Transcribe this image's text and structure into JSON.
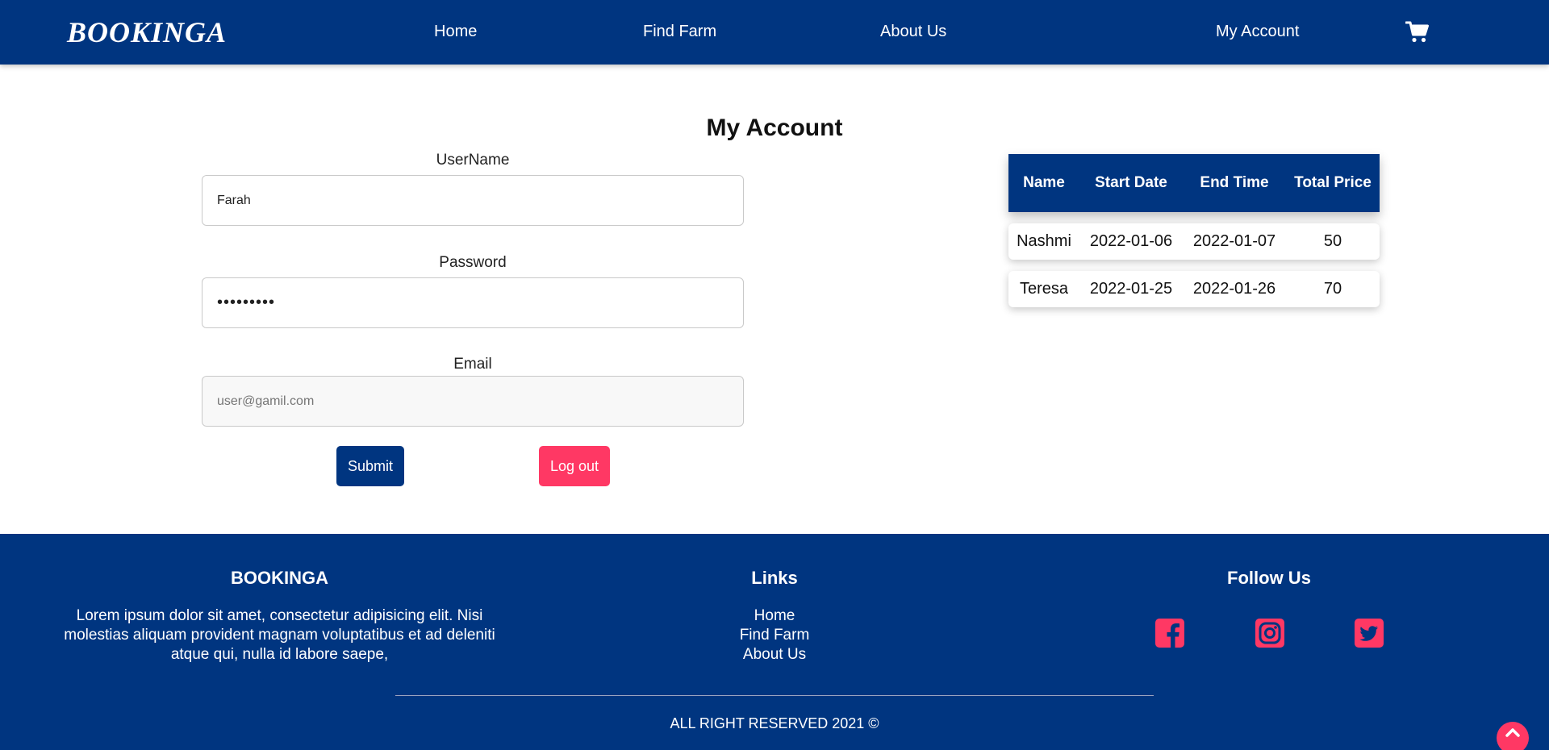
{
  "nav": {
    "brand": "BOOKINGA",
    "links": [
      "Home",
      "Find Farm",
      "About Us",
      "My Account"
    ],
    "cart_icon": "cart-icon"
  },
  "main": {
    "title": "My Account",
    "form": {
      "username_label": "UserName",
      "username_value": "Farah",
      "password_label": "Password",
      "password_value": "•••••••••",
      "email_label": "Email",
      "email_placeholder": "user@gamil.com",
      "submit_label": "Submit",
      "logout_label": "Log out"
    },
    "bookings": {
      "headers": [
        "Name",
        "Start Date",
        "End Time",
        "Total Price"
      ],
      "rows": [
        [
          "Nashmi",
          "2022-01-06",
          "2022-01-07",
          "50"
        ],
        [
          "Teresa",
          "2022-01-25",
          "2022-01-26",
          "70"
        ]
      ]
    }
  },
  "footer": {
    "about_title": "BOOKINGA",
    "about_text": "Lorem ipsum dolor sit amet, consectetur adipisicing elit. Nisi molestias aliquam provident magnam voluptatibus et ad deleniti atque qui, nulla id labore saepe,",
    "links_title": "Links",
    "links": [
      "Home",
      "Find Farm",
      "About Us"
    ],
    "follow_title": "Follow Us",
    "social_icons": [
      "facebook-icon",
      "instagram-icon",
      "twitter-icon"
    ],
    "copyright": "ALL RIGHT RESERVED 2021 ©"
  },
  "colors": {
    "primary": "#003580",
    "accent": "#ff3864",
    "background": "#ffffff"
  }
}
